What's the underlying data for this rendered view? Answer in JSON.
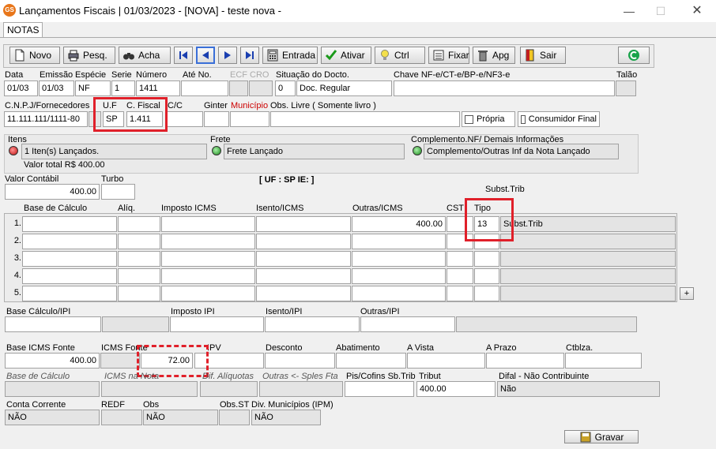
{
  "window": {
    "title": "Lançamentos Fiscais |  01/03/2023 - [NOVA] - teste nova -",
    "app_icon_text": "GS"
  },
  "tabs": [
    {
      "label": "NOTAS"
    }
  ],
  "toolbar": {
    "novo": "Novo",
    "pesq": "Pesq.",
    "acha": "Acha",
    "entrada": "Entrada",
    "ativar": "Ativar",
    "ctrl": "Ctrl",
    "fixar": "Fixar",
    "apg": "Apg",
    "sair": "Sair"
  },
  "header": {
    "labels": {
      "data": "Data",
      "emissao": "Emissão",
      "especie": "Espécie",
      "serie": "Serie",
      "numero": "Número",
      "ate_no": "Até No.",
      "ecf": "ECF",
      "cro": "CRO",
      "situacao": "Situação do Docto.",
      "chave": "Chave NF-e/CT-e/BP-e/NF3-e",
      "talao": "Talão"
    },
    "values": {
      "data": "01/03",
      "emissao": "01/03",
      "especie": "NF",
      "serie": "1",
      "numero": "1411",
      "situacao_code": "0",
      "situacao_desc": "Doc. Regular"
    }
  },
  "row2": {
    "labels": {
      "cnpj": "C.N.P.J/Fornecedores",
      "uf": "U.F",
      "cfiscal": "C. Fiscal",
      "cc": "C/C",
      "ginter": "Ginter",
      "municipio": "Município",
      "obs_livre": "Obs. Livre ( Somente livro )",
      "propria": "Própria",
      "consumidor_final": "Consumidor Final"
    },
    "values": {
      "cnpj": "11.111.111/1111-80",
      "uf": "SP",
      "cfiscal": "1.411"
    }
  },
  "status": {
    "itens_label": "Itens",
    "itens_value": "1 Iten(s) Lançados.",
    "valor_total": "Valor total R$ 400.00",
    "frete_label": "Frete",
    "frete_value": "Frete Lançado",
    "complemento_label": "Complemento.NF/ Demais Informações",
    "complemento_value": "Complemento/Outras Inf da Nota Lançado"
  },
  "valores": {
    "valor_contabil_label": "Valor Contábil",
    "valor_contabil": "400.00",
    "turbo_label": "Turbo",
    "uf_ie": "[ UF : SP IE: ]",
    "subst_trib_label": "Subst.Trib"
  },
  "grid": {
    "headers": {
      "base": "Base de Cálculo",
      "aliq": "Alíq.",
      "imposto": "Imposto ICMS",
      "isento": "Isento/ICMS",
      "outras": "Outras/ICMS",
      "cst": "CST",
      "tipo": "Tipo"
    },
    "rows": [
      {
        "num": "1.",
        "outras": "400.00",
        "tipo": "13",
        "tipo_desc": "Subst.Trib"
      },
      {
        "num": "2.",
        "outras": "",
        "tipo": "",
        "tipo_desc": ""
      },
      {
        "num": "3.",
        "outras": "",
        "tipo": "",
        "tipo_desc": ""
      },
      {
        "num": "4.",
        "outras": "",
        "tipo": "",
        "tipo_desc": ""
      },
      {
        "num": "5.",
        "outras": "",
        "tipo": "",
        "tipo_desc": ""
      }
    ],
    "plus": "+"
  },
  "ipi": {
    "base_label": "Base Cálculo/IPI",
    "imposto_label": "Imposto IPI",
    "isento_label": "Isento/IPI",
    "outras_label": "Outras/IPI"
  },
  "icms_fonte": {
    "base_label": "Base ICMS Fonte",
    "base": "400.00",
    "icms_label": "ICMS Fonte",
    "icms": "72.00",
    "ipv_label": "IPV",
    "desconto_label": "Desconto",
    "abatimento_label": "Abatimento",
    "a_vista_label": "A Vista",
    "a_prazo_label": "A Prazo",
    "ctblza_label": "Ctblza."
  },
  "misc": {
    "base_calc_label": "Base de Cálculo",
    "icms_na_nota_label": "ICMS na Nota",
    "dif_aliq_label": "Dif. Alíquotas",
    "outras_sples_label": "Outras <- Sples Fta",
    "pis_label": "Pis/Cofins Sb.Trib",
    "tribut_label": "Tribut",
    "tribut": "400.00",
    "difal_label": "Difal - Não Contribuinte",
    "difal": "Não"
  },
  "footer": {
    "conta_label": "Conta Corrente",
    "conta": "NÃO",
    "redf_label": "REDF",
    "obs_label": "Obs",
    "obs": "NÃO",
    "obs_st_label": "Obs.ST",
    "div_label": "Div. Municípios (IPM)",
    "div": "NÃO",
    "gravar": "Gravar"
  },
  "colors": {
    "accent_red": "#e0202a",
    "municipio_red": "#cc0000"
  }
}
